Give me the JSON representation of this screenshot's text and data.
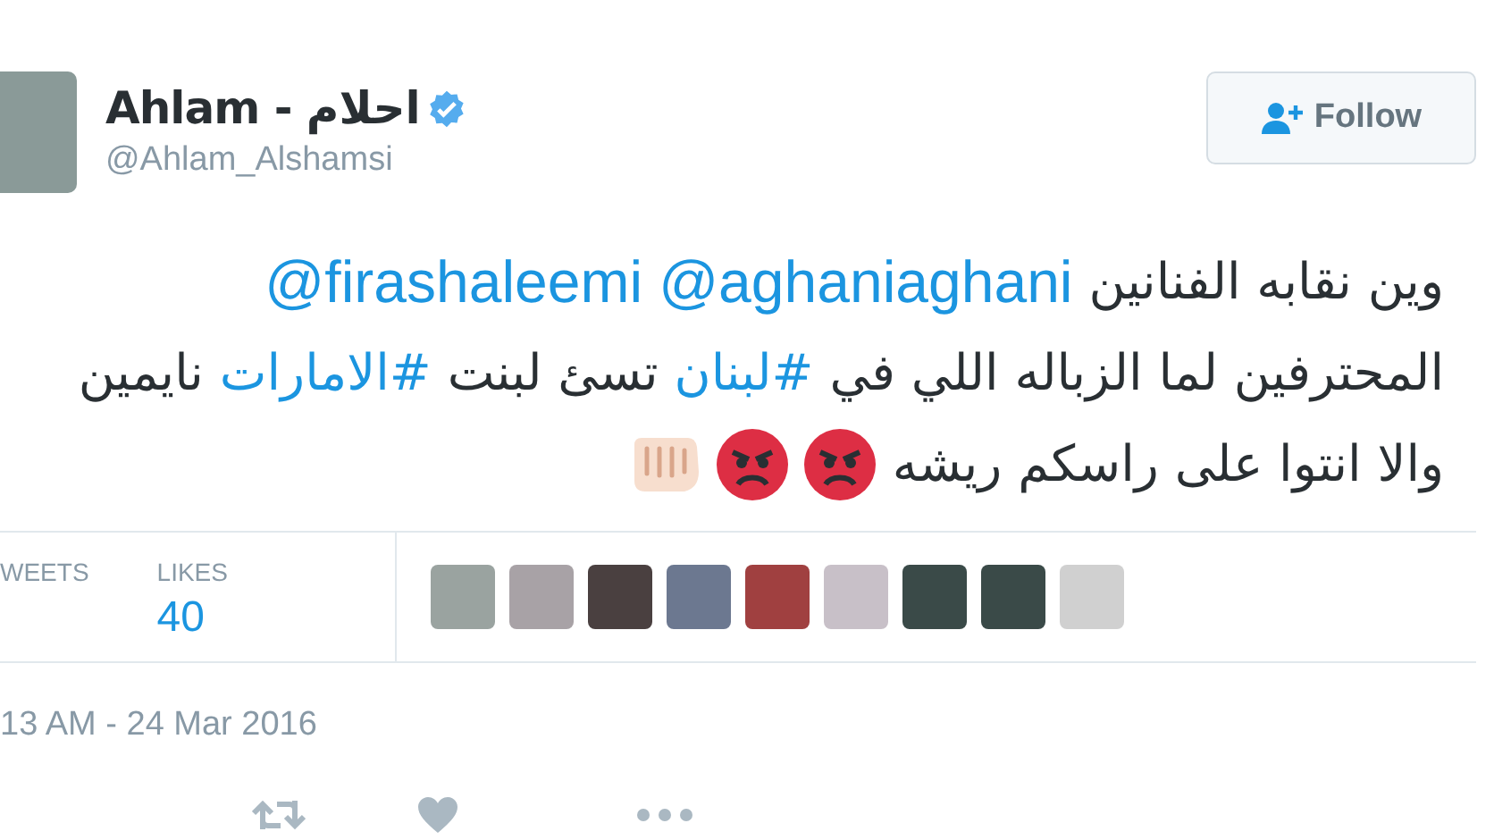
{
  "author": {
    "name": "Ahlam - احلام",
    "verified": true,
    "handle": "@Ahlam_Alshamsi"
  },
  "follow_button": {
    "label": "Follow"
  },
  "tweet_lines": [
    [
      {
        "kind": "text",
        "text": "وين نقابه الفنانين"
      },
      {
        "kind": "mention",
        "text": "@aghaniaghani"
      },
      {
        "kind": "mention",
        "text": "@firashaleemi"
      }
    ],
    [
      {
        "kind": "text",
        "text": "المحترفين لما الزباله اللي في"
      },
      {
        "kind": "hashtag",
        "text": "#لبنان"
      },
      {
        "kind": "text",
        "text": "تسئ لبنت"
      },
      {
        "kind": "hashtag",
        "text": "#الامارات"
      },
      {
        "kind": "text",
        "text": "نايمين"
      }
    ],
    [
      {
        "kind": "text",
        "text": "والا انتوا على راسكم ريشه"
      },
      {
        "kind": "angry-emoji"
      },
      {
        "kind": "angry-emoji"
      },
      {
        "kind": "fist-emoji"
      }
    ]
  ],
  "retweets": {
    "label": "WEETS"
  },
  "likes": {
    "label": "LIKES",
    "value": "40"
  },
  "liker_avatars": [
    {
      "kind": "photo"
    },
    {
      "kind": "photo"
    },
    {
      "kind": "photo"
    },
    {
      "kind": "photo"
    },
    {
      "kind": "photo"
    },
    {
      "kind": "photo"
    },
    {
      "kind": "photo"
    },
    {
      "kind": "photo"
    },
    {
      "kind": "photo"
    }
  ],
  "timestamp": "13 AM - 24 Mar 2016"
}
